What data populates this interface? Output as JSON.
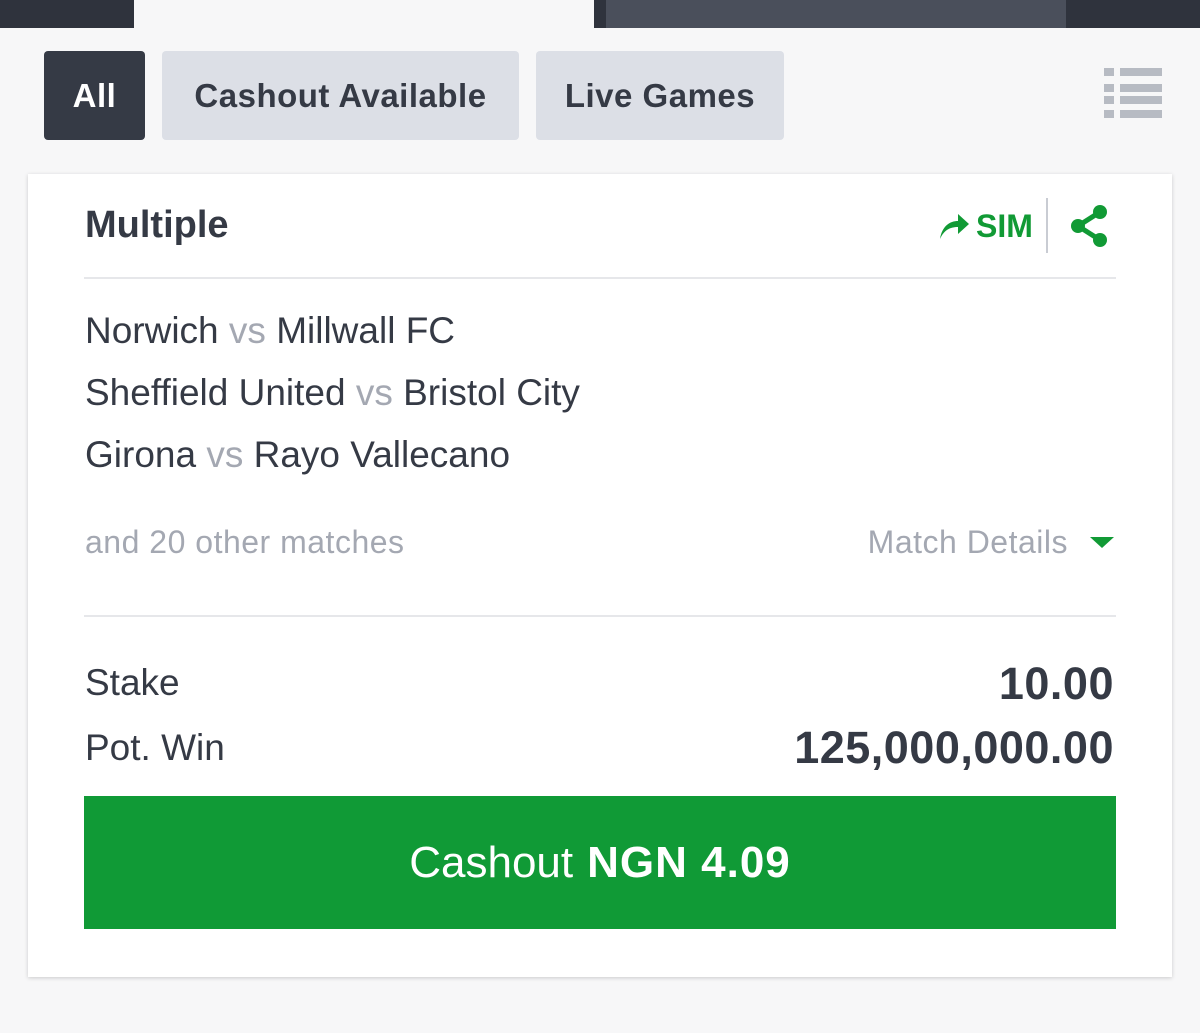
{
  "filters": [
    {
      "label": "All",
      "active": true
    },
    {
      "label": "Cashout Available",
      "active": false
    },
    {
      "label": "Live Games",
      "active": false
    }
  ],
  "ticket": {
    "title": "Multiple",
    "sim_label": "SIM",
    "matches": [
      {
        "home": "Norwich",
        "vs": "vs",
        "away": "Millwall FC"
      },
      {
        "home": "Sheffield United",
        "vs": "vs",
        "away": "Bristol City"
      },
      {
        "home": "Girona",
        "vs": "vs",
        "away": "Rayo Vallecano"
      }
    ],
    "other_matches": "and 20 other matches",
    "details_label": "Match Details",
    "stake_label": "Stake",
    "stake_value": "10.00",
    "potwin_label": "Pot. Win",
    "potwin_value": "125,000,000.00",
    "cashout_label": "Cashout",
    "cashout_amount": "NGN 4.09"
  },
  "colors": {
    "accent": "#109a36",
    "dark": "#353a45",
    "muted": "#a4a8b2",
    "pill_inactive": "#dcdfe6"
  },
  "icons": {
    "list": "list-icon",
    "sim": "forward-arrow-icon",
    "share": "share-icon",
    "details": "caret-down-icon"
  }
}
